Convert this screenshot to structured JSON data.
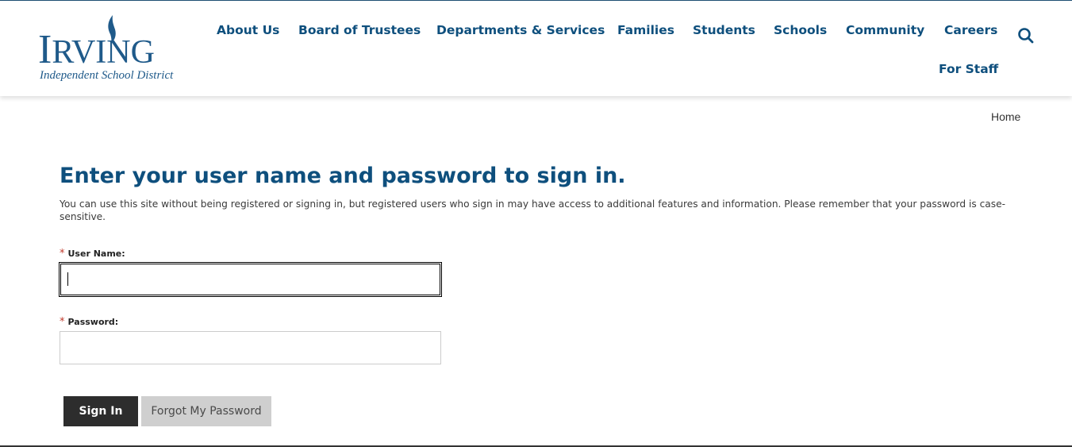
{
  "brand": {
    "name_first": "I",
    "name_rest": "RVING",
    "tagline": "Independent School District",
    "color": "#1f5a8a"
  },
  "nav": {
    "items": [
      {
        "label": "About Us"
      },
      {
        "label": "Board of Trustees"
      },
      {
        "label": "Departments & Services"
      },
      {
        "label": "Families"
      },
      {
        "label": "Students"
      },
      {
        "label": "Schools"
      },
      {
        "label": "Community"
      },
      {
        "label": "Careers"
      },
      {
        "label": "For Staff"
      }
    ],
    "search_icon": "search-icon",
    "color": "#0e4f7d"
  },
  "breadcrumb": {
    "home": "Home"
  },
  "main": {
    "title": "Enter your user name and password to sign in.",
    "intro": "You can use this site without being registered or signing in, but registered users who sign in may have access to additional features and information. Please remember that your password is case-sensitive.",
    "username": {
      "required_mark": "*",
      "label": "User Name:",
      "value": ""
    },
    "password": {
      "required_mark": "*",
      "label": "Password:",
      "value": ""
    },
    "buttons": {
      "sign_in": "Sign In",
      "forgot": "Forgot My Password"
    }
  },
  "colors": {
    "accent": "#0e4f7d",
    "required": "#c0392b",
    "primary_button": "#2d2d2d",
    "secondary_button": "#cfcfcf"
  }
}
